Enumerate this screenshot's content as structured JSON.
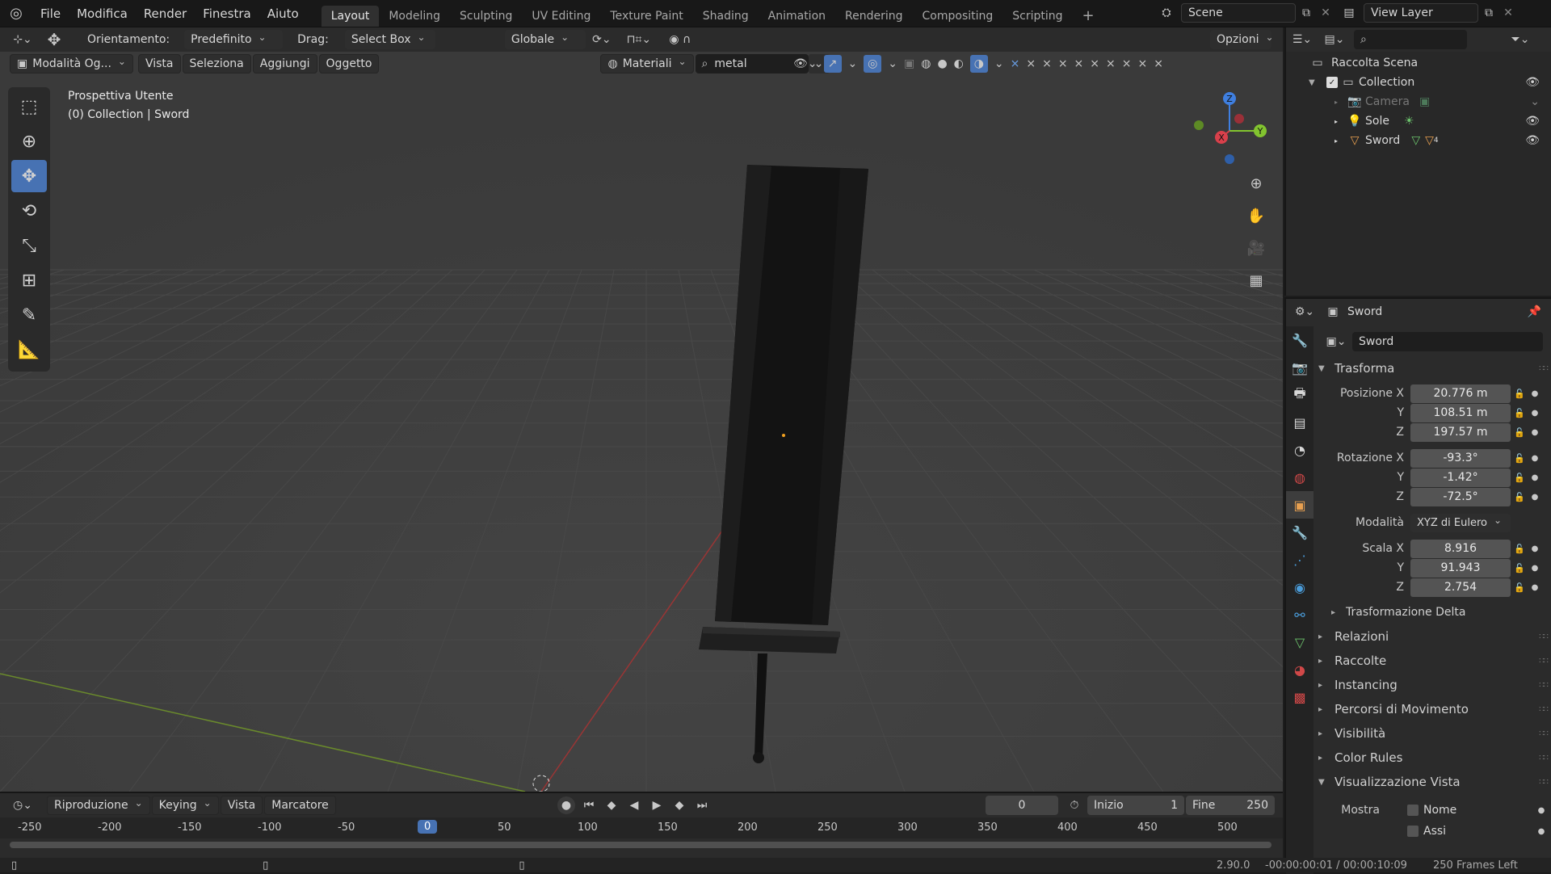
{
  "topbar": {
    "menus": [
      "File",
      "Modifica",
      "Render",
      "Finestra",
      "Aiuto"
    ],
    "workspaces": [
      "Layout",
      "Modeling",
      "Sculpting",
      "UV Editing",
      "Texture Paint",
      "Shading",
      "Animation",
      "Rendering",
      "Compositing",
      "Scripting"
    ],
    "active_workspace": "Layout",
    "add_tab": "+",
    "scene": "Scene",
    "view_layer": "View Layer"
  },
  "viewport_header": {
    "orientation_label": "Orientamento:",
    "orientation_value": "Predefinito",
    "drag_label": "Drag:",
    "drag_value": "Select Box",
    "transform_space": "Globale",
    "options": "Opzioni",
    "mode": "Modalità Og...",
    "menus": [
      "Vista",
      "Seleziona",
      "Aggiungi",
      "Oggetto"
    ],
    "material_mode": "Materiali",
    "search_value": "metal"
  },
  "viewport": {
    "view_name": "Prospettiva Utente",
    "collection_info": "(0) Collection | Sword",
    "gizmo": {
      "x": "X",
      "y": "Y",
      "z": "Z"
    }
  },
  "outliner": {
    "title": "Raccolta Scena",
    "items": [
      {
        "label": "Collection",
        "icon": "collection-icon"
      },
      {
        "label": "Camera",
        "icon": "camera-icon"
      },
      {
        "label": "Sole",
        "icon": "sun-icon"
      },
      {
        "label": "Sword",
        "icon": "mesh-icon"
      }
    ],
    "sword_badge": "4"
  },
  "properties": {
    "object_name": "Sword",
    "data_name": "Sword",
    "transform_title": "Trasforma",
    "position_label": "Posizione X",
    "rotation_label": "Rotazione X",
    "scale_label": "Scala X",
    "y_label": "Y",
    "z_label": "Z",
    "position": [
      "20.776 m",
      "108.51 m",
      "197.57 m"
    ],
    "rotation": [
      "-93.3°",
      "-1.42°",
      "-72.5°"
    ],
    "mode_label": "Modalità",
    "mode_value": "XYZ di Eulero",
    "scale": [
      "8.916",
      "91.943",
      "2.754"
    ],
    "delta_title": "Trasformazione Delta",
    "sections": [
      "Relazioni",
      "Raccolte",
      "Instancing",
      "Percorsi di Movimento",
      "Visibilità",
      "Color Rules"
    ],
    "viewport_display_title": "Visualizzazione Vista",
    "show_label": "Mostra",
    "show_name": "Nome",
    "show_axes": "Assi"
  },
  "timeline": {
    "menus": [
      "Riproduzione",
      "Keying",
      "Vista",
      "Marcatore"
    ],
    "current_frame": "0",
    "start_label": "Inizio",
    "start_value": "1",
    "end_label": "Fine",
    "end_value": "250",
    "ruler": [
      "-250",
      "-200",
      "-150",
      "-100",
      "-50",
      "0",
      "50",
      "100",
      "150",
      "200",
      "250",
      "300",
      "350",
      "400",
      "450",
      "500"
    ]
  },
  "statusbar": {
    "version": "2.90.0",
    "time": "-00:00:00:01 / 00:00:10:09",
    "frames_left": "250 Frames Left"
  },
  "colors": {
    "accent": "#4772b3",
    "x_axis": "#d9404b",
    "y_axis": "#82c42f",
    "z_axis": "#3f7fe0"
  }
}
